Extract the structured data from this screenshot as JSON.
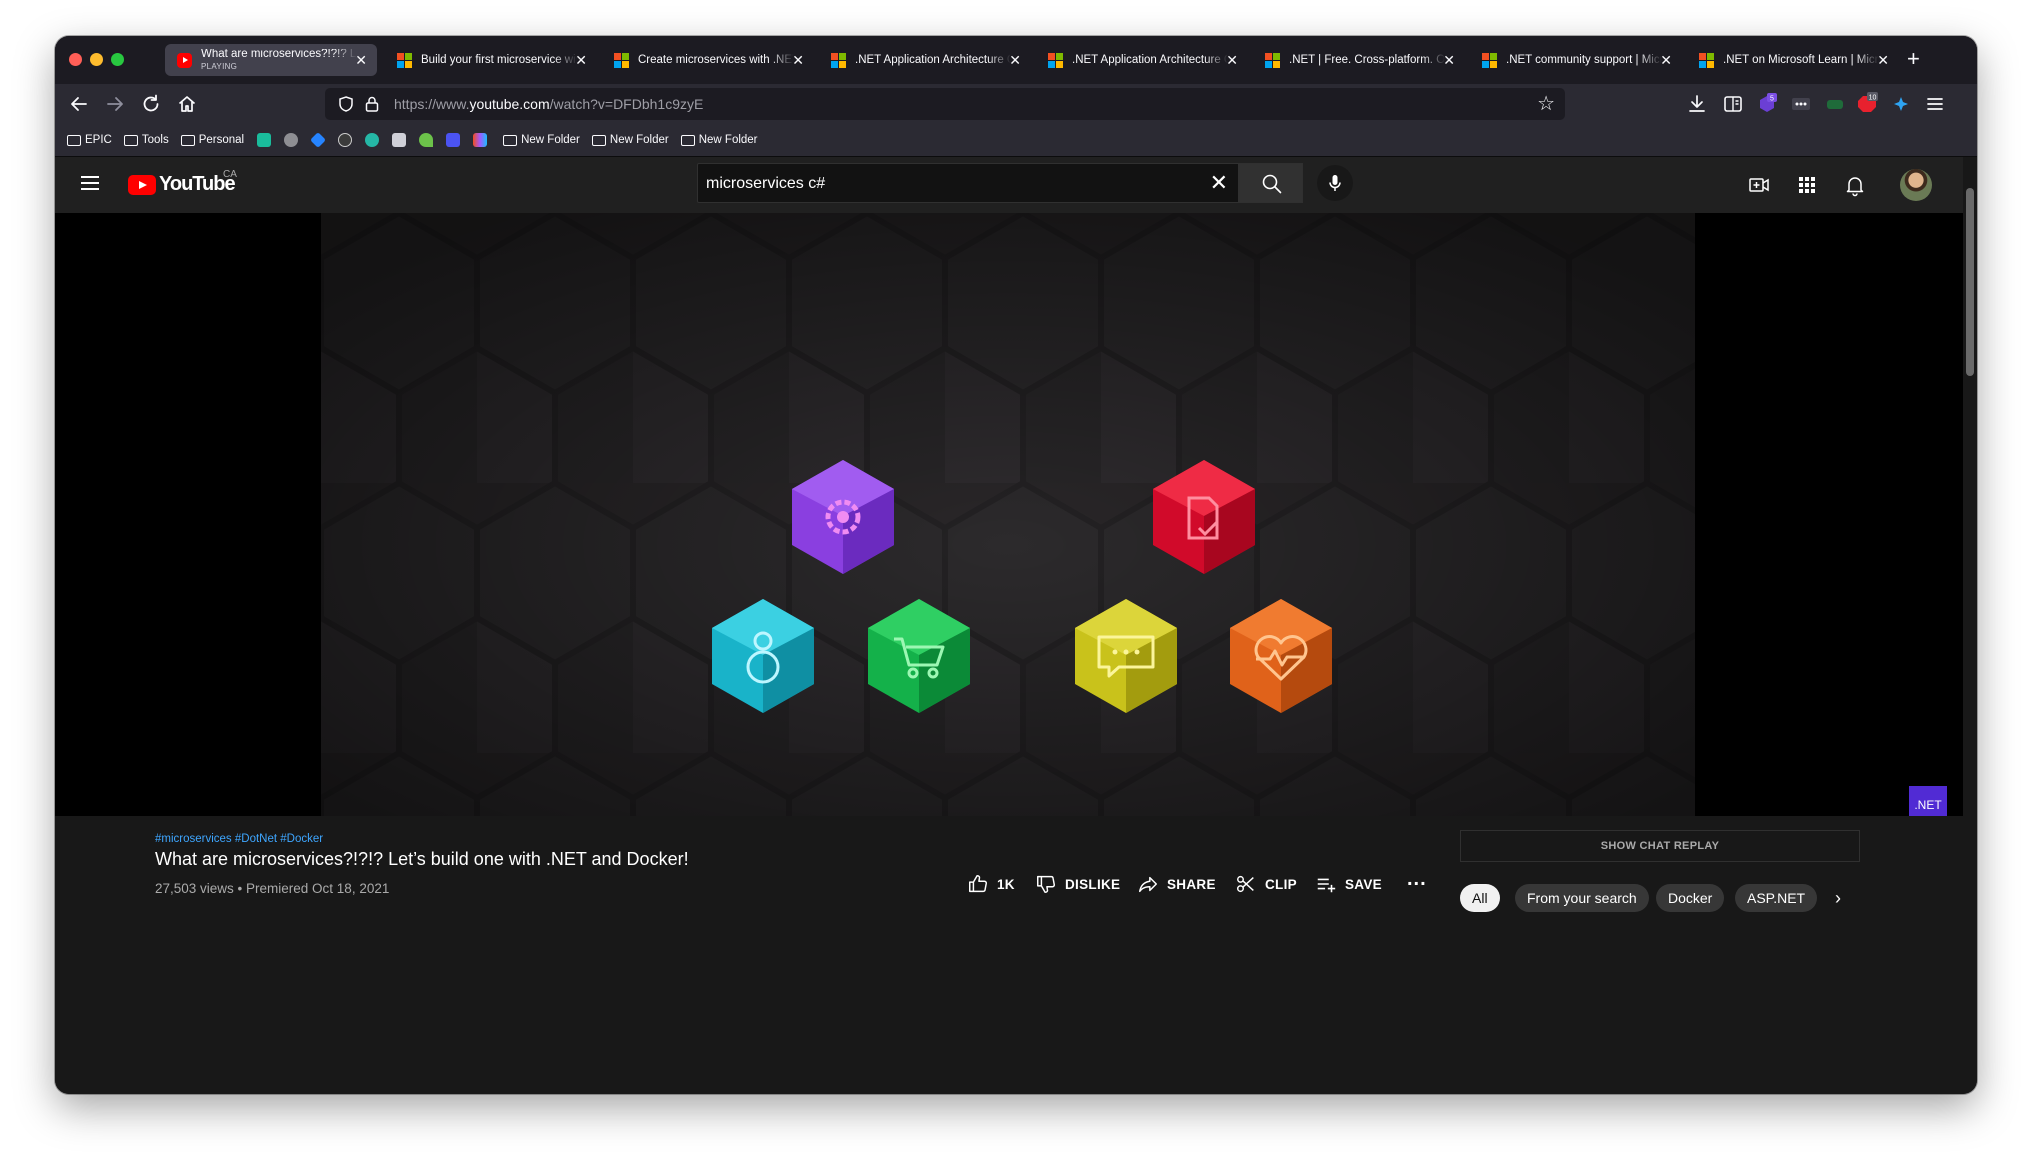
{
  "browser": {
    "tabs": [
      {
        "title": "What are microservices?!?!? Let's build one with .NET and Docker!",
        "subtitle": "PLAYING",
        "active": true,
        "favicon": "youtube-icon"
      },
      {
        "title": "Build your first microservice with .NET",
        "active": false,
        "favicon": "microsoft-icon"
      },
      {
        "title": "Create microservices with .NET and ASP.NET Core",
        "active": false,
        "favicon": "microsoft-icon"
      },
      {
        "title": ".NET Application Architecture Guides",
        "active": false,
        "favicon": "microsoft-icon"
      },
      {
        "title": ".NET Application Architecture Guides",
        "active": false,
        "favicon": "microsoft-icon"
      },
      {
        "title": ".NET | Free. Cross-platform. Open Source.",
        "active": false,
        "favicon": "microsoft-icon"
      },
      {
        "title": ".NET community support | Microsoft",
        "active": false,
        "favicon": "microsoft-icon"
      },
      {
        "title": ".NET on Microsoft Learn | Microsoft",
        "active": false,
        "favicon": "microsoft-icon"
      }
    ],
    "url_prefix": "https://www.",
    "url_domain": "youtube.com",
    "url_path": "/watch?v=DFDbh1c9zyE",
    "bookmarks": {
      "epic": "EPIC",
      "tools": "Tools",
      "personal": "Personal",
      "new_folder_1": "New Folder",
      "new_folder_2": "New Folder",
      "new_folder_3": "New Folder"
    },
    "extension_badges": {
      "ext1": "5",
      "ext2": "10"
    }
  },
  "youtube": {
    "logo_text": "YouTube",
    "country": "CA",
    "search_value": "microservices c#",
    "net_badge": ".NET"
  },
  "video": {
    "hashtags": "#microservices #DotNet #Docker",
    "title": "What are microservices?!?!? Let’s build one with .NET and Docker!",
    "meta": "27,503 views • Premiered Oct 18, 2021",
    "actions": {
      "like": "1K",
      "dislike": "DISLIKE",
      "share": "SHARE",
      "clip": "CLIP",
      "save": "SAVE",
      "more": "..."
    }
  },
  "sidebar": {
    "show_chat_replay": "SHOW CHAT REPLAY",
    "chips": [
      "All",
      "From your search",
      "Docker",
      "ASP.NET"
    ]
  },
  "colors": {
    "gear_hex": "#8a3fe0",
    "doc_hex": "#e0102e",
    "user_hex": "#19b3c9",
    "cart_hex": "#14b14a",
    "chat_hex": "#c9c21b",
    "health_hex": "#e0621a",
    "net_purple": "#512bd4",
    "link_blue": "#3ea6ff"
  }
}
